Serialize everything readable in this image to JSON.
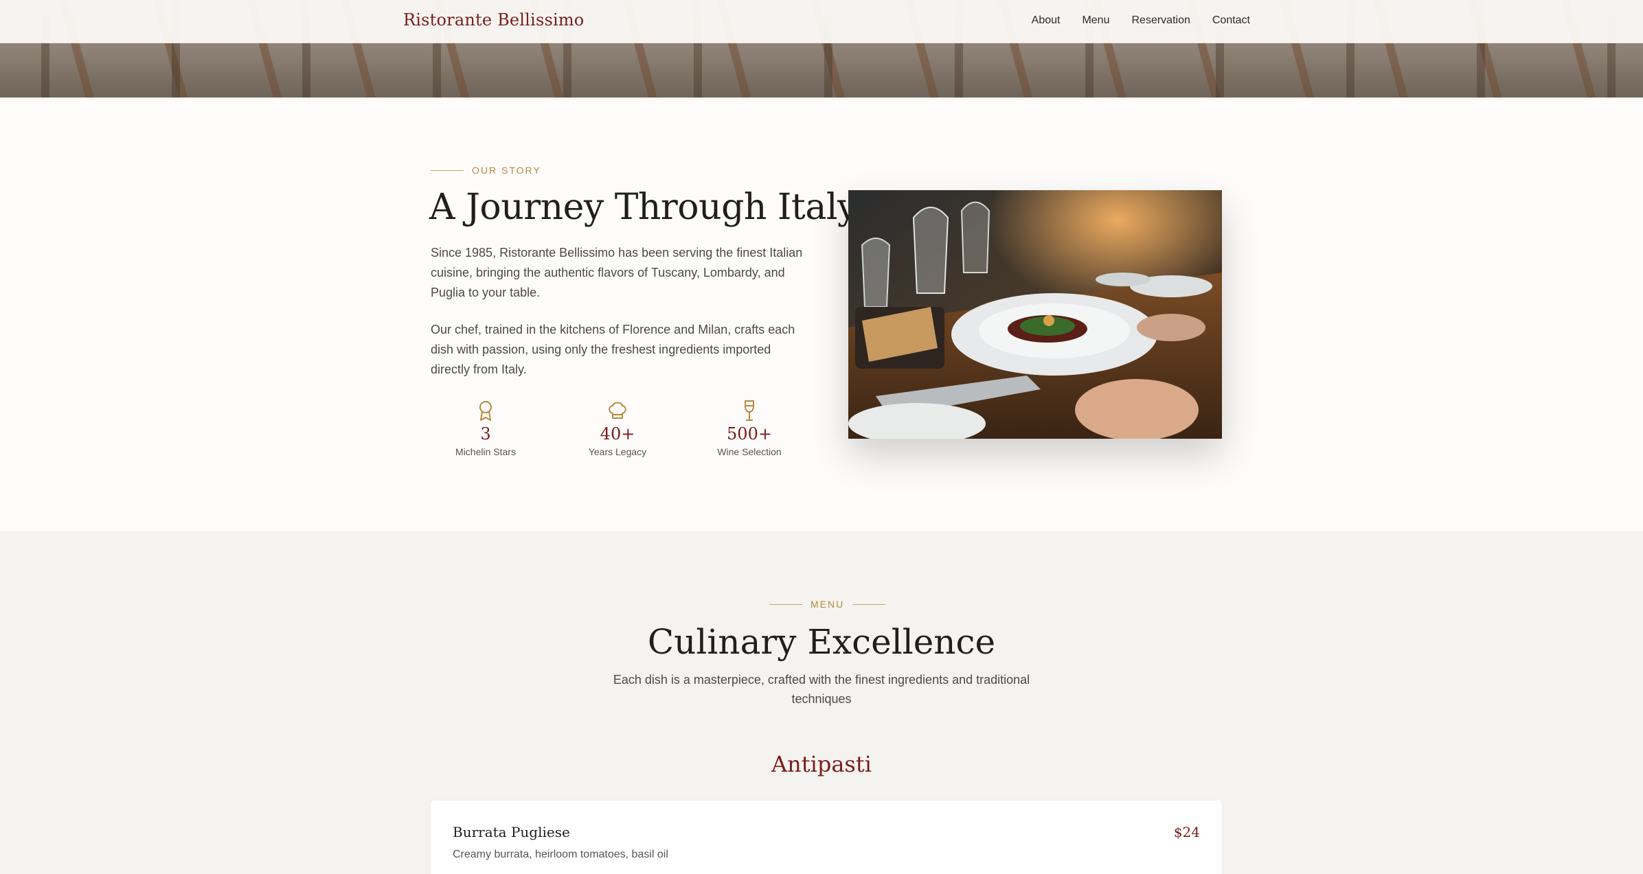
{
  "nav": {
    "brand": "Ristorante Bellissimo",
    "links": [
      "About",
      "Menu",
      "Reservation",
      "Contact"
    ]
  },
  "story": {
    "eyebrow": "OUR STORY",
    "title": "A Journey Through Italy",
    "paragraphs": [
      "Since 1985, Ristorante Bellissimo has been serving the finest Italian cuisine, bringing the authentic flavors of Tuscany, Lombardy, and Puglia to your table.",
      "Our chef, trained in the kitchens of Florence and Milan, crafts each dish with passion, using only the freshest ingredients imported directly from Italy."
    ],
    "stats": [
      {
        "icon": "award-icon",
        "value": "3",
        "label": "Michelin Stars"
      },
      {
        "icon": "chef-hat-icon",
        "value": "40+",
        "label": "Years Legacy"
      },
      {
        "icon": "wine-glass-icon",
        "value": "500+",
        "label": "Wine Selection"
      }
    ],
    "photo_icon": "dining-table-photo"
  },
  "menu": {
    "eyebrow": "MENU",
    "title": "Culinary Excellence",
    "subtitle": "Each dish is a masterpiece, crafted with the finest ingredients and traditional techniques",
    "category": "Antipasti",
    "items": [
      {
        "name": "Burrata Pugliese",
        "price": "$24",
        "description": "Creamy burrata, heirloom tomatoes, basil oil"
      }
    ]
  },
  "colors": {
    "accent_red": "#7a1c1c",
    "accent_gold": "#b5893e",
    "section_bg": "#f5f3ef"
  }
}
